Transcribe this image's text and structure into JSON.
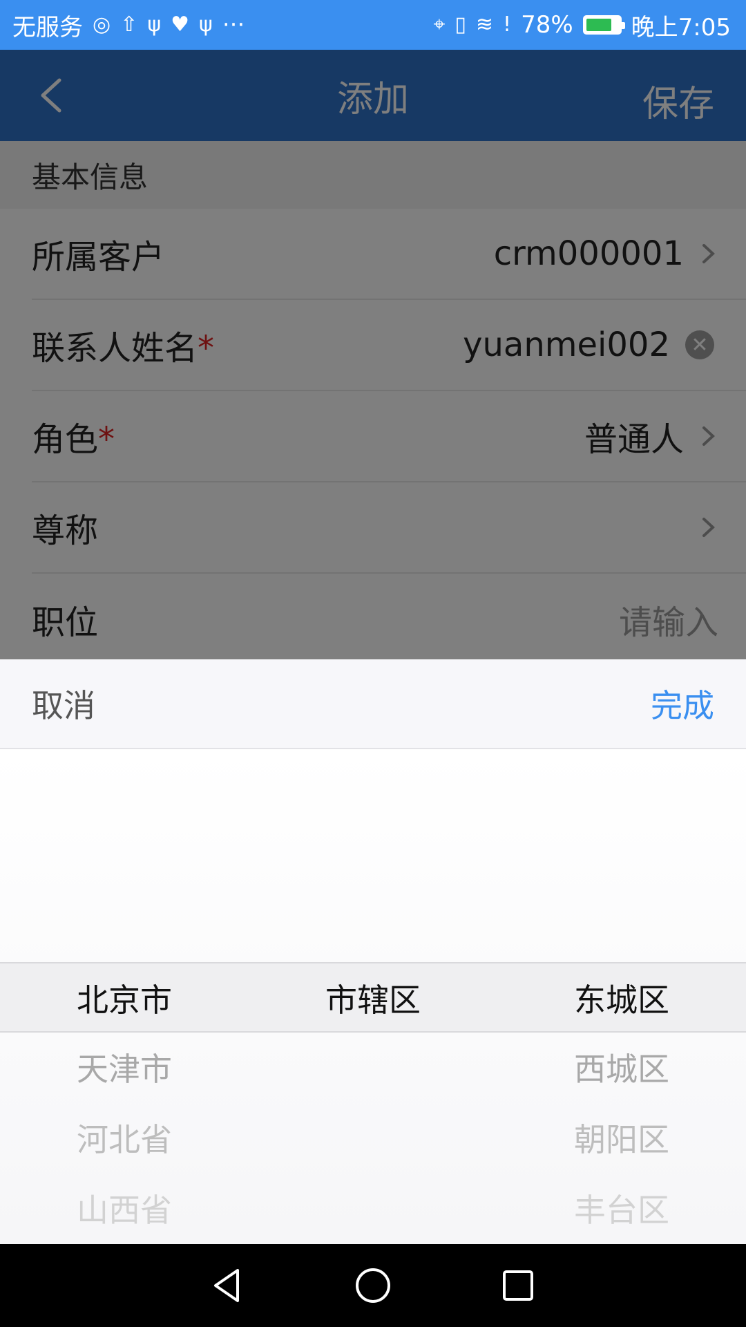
{
  "status_bar": {
    "carrier": "无服务",
    "more": "···",
    "battery_text": "78%",
    "battery_level": 0.78,
    "time": "晚上7:05"
  },
  "nav": {
    "title": "添加",
    "save_label": "保存"
  },
  "form": {
    "section_title": "基本信息",
    "rows": [
      {
        "label": "所属客户",
        "required": "",
        "value": "crm000001"
      },
      {
        "label": "联系人姓名",
        "required": "*",
        "value": "yuanmei002"
      },
      {
        "label": "角色",
        "required": "*",
        "value": "普通人"
      },
      {
        "label": "尊称",
        "required": "",
        "value": ""
      },
      {
        "label": "职位",
        "required": "",
        "placeholder": "请输入"
      }
    ]
  },
  "picker": {
    "cancel_label": "取消",
    "done_label": "完成",
    "province": {
      "selected": "北京市",
      "items": [
        "天津市",
        "河北省",
        "山西省"
      ]
    },
    "city": {
      "selected": "市辖区",
      "items": [
        "",
        "",
        ""
      ]
    },
    "district": {
      "selected": "东城区",
      "items": [
        "西城区",
        "朝阳区",
        "丰台区"
      ]
    }
  },
  "colors": {
    "status_bar": "#3a8ff0",
    "nav_bar": "#2f73c8",
    "accent": "#3a8ff0",
    "required": "#dd2222"
  }
}
